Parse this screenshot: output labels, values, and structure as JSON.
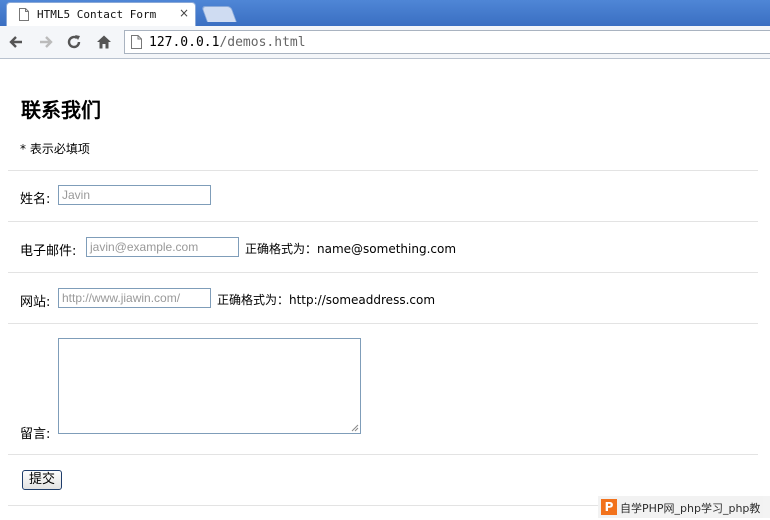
{
  "browser": {
    "tab_title": "HTML5 Contact Form",
    "tab_close": "×",
    "url_host": "127.0.0.1",
    "url_path": "/demos.html"
  },
  "form": {
    "title": "联系我们",
    "required_note": "* 表示必填项",
    "name_label": "姓名:",
    "name_placeholder": "Javin",
    "email_label": "电子邮件:",
    "email_placeholder": "javin@example.com",
    "email_hint": "正确格式为：name@something.com",
    "website_label": "网站:",
    "website_placeholder": "http://www.jiawin.com/",
    "website_hint": "正确格式为：http://someaddress.com",
    "message_label": "留言:",
    "submit_label": "提交"
  },
  "watermark": {
    "logo": "P",
    "text": "自学PHP网_php学习_php教"
  }
}
